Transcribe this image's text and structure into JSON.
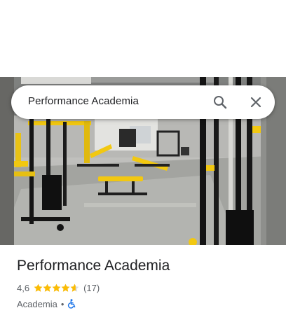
{
  "search": {
    "query": "Performance Academia"
  },
  "place": {
    "name": "Performance Academia",
    "rating": "4,6",
    "rating_fraction": 0.92,
    "stars_filled": 4,
    "stars_partial": 0.6,
    "review_count": "(17)",
    "category": "Academia",
    "separator": "•"
  },
  "icons": {
    "search": "search-icon",
    "close": "close-icon",
    "star": "star-icon",
    "accessibility": "wheelchair-icon"
  },
  "colors": {
    "star": "#fbbc04",
    "accessibility": "#1a73e8",
    "text_primary": "#202124",
    "text_secondary": "#5f6368",
    "equipment_yellow": "#f2c811"
  }
}
